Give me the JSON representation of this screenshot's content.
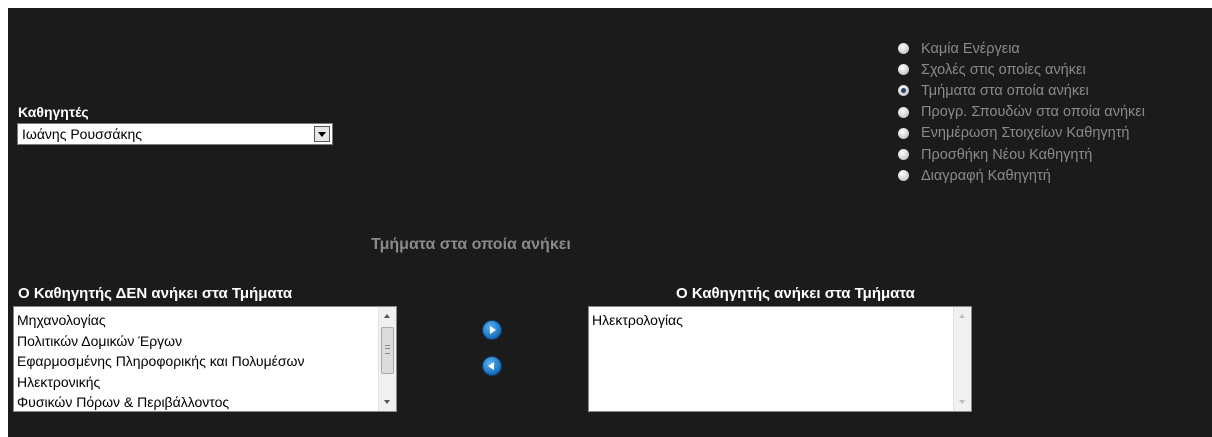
{
  "professor": {
    "label": "Καθηγητές",
    "selected": "Ιωάνης Ρουσσάκης"
  },
  "actions": {
    "options": [
      {
        "label": "Καμία Ενέργεια",
        "checked": false
      },
      {
        "label": "Σχολές στις οποίες ανήκει",
        "checked": false
      },
      {
        "label": "Τμήματα στα οποία ανήκει",
        "checked": true
      },
      {
        "label": "Προγρ. Σπουδών στα οποία ανήκει",
        "checked": false
      },
      {
        "label": "Ενημέρωση Στοιχείων Καθηγητή",
        "checked": false
      },
      {
        "label": "Προσθήκη Νέου Καθηγητή",
        "checked": false
      },
      {
        "label": "Διαγραφή Καθηγητή",
        "checked": false
      }
    ]
  },
  "section_title": "Τμήματα στα οποία ανήκει",
  "not_member": {
    "title": "Ο Καθηγητής ΔΕΝ ανήκει στα Τμήματα",
    "items": [
      "Μηχανολογίας",
      "Πολιτικών Δομικών Έργων",
      "Εφαρμοσμένης Πληροφορικής και Πολυμέσων",
      "Ηλεκτρονικής",
      "Φυσικών Πόρων & Περιβάλλοντος"
    ]
  },
  "member": {
    "title": "Ο Καθηγητής ανήκει στα Τμήματα",
    "items": [
      "Ηλεκτρολογίας"
    ]
  },
  "buttons": {
    "add_icon": "play-right-icon",
    "remove_icon": "play-left-icon"
  }
}
